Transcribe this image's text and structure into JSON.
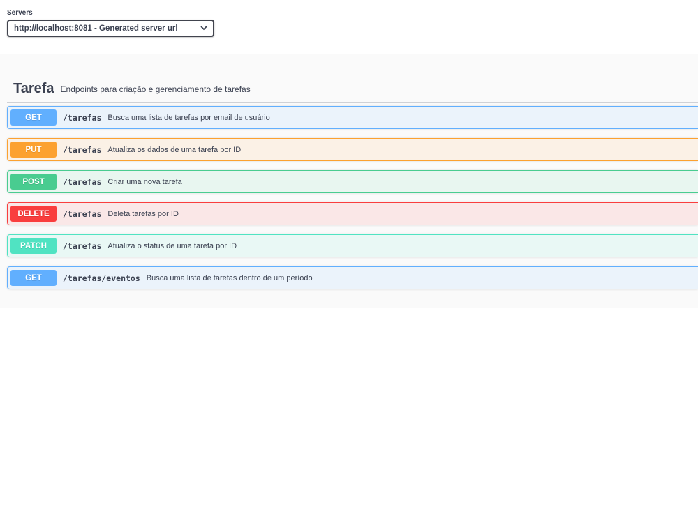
{
  "servers": {
    "label": "Servers",
    "selected": "http://localhost:8081 - Generated server url"
  },
  "tag": {
    "name": "Tarefa",
    "description": "Endpoints para criação e gerenciamento de tarefas"
  },
  "operations": [
    {
      "method": "GET",
      "path": "/tarefas",
      "summary": "Busca uma lista de tarefas por email de usuário",
      "color": "#61affe"
    },
    {
      "method": "PUT",
      "path": "/tarefas",
      "summary": "Atualiza os dados de uma tarefa por ID",
      "color": "#fca130"
    },
    {
      "method": "POST",
      "path": "/tarefas",
      "summary": "Criar uma nova tarefa",
      "color": "#49cc90"
    },
    {
      "method": "DELETE",
      "path": "/tarefas",
      "summary": "Deleta tarefas por ID",
      "color": "#f93e3e"
    },
    {
      "method": "PATCH",
      "path": "/tarefas",
      "summary": "Atualiza o status de uma tarefa por ID",
      "color": "#50e3c2"
    },
    {
      "method": "GET",
      "path": "/tarefas/eventos",
      "summary": "Busca uma lista de tarefas dentro de um período",
      "color": "#61affe"
    }
  ]
}
